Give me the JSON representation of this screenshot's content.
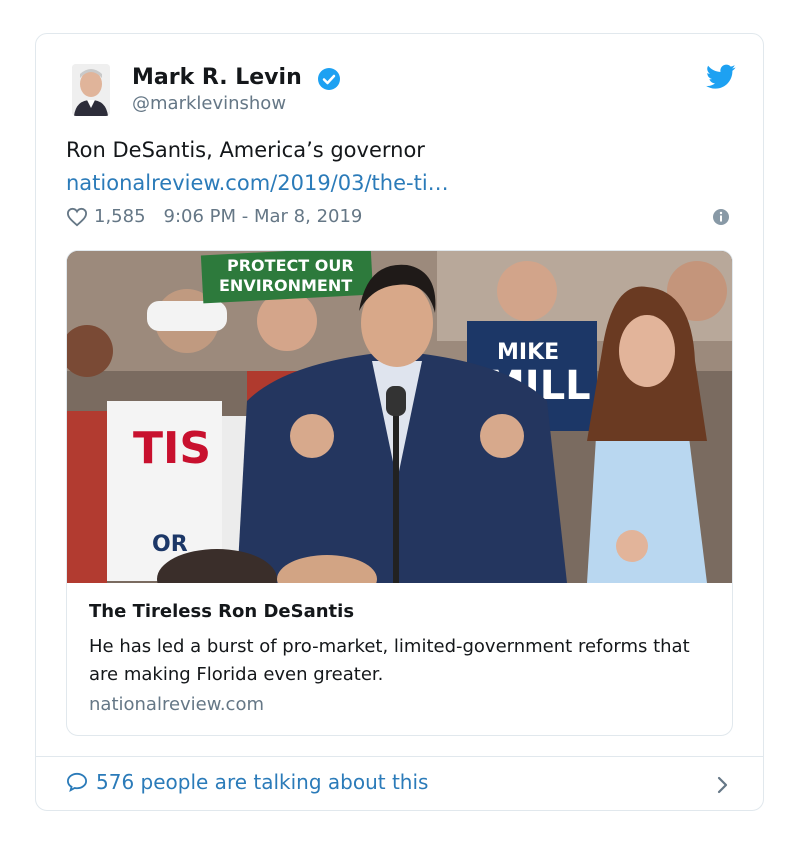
{
  "tweet": {
    "author_name": "Mark R. Levin",
    "handle": "@marklevinshow",
    "verified": true,
    "text": "Ron DeSantis, America’s governor",
    "link_text": "nationalreview.com/2019/03/the-ti…",
    "like_count": "1,585",
    "timestamp": "9:06 PM - Mar 8, 2019"
  },
  "link_card": {
    "image_signs": {
      "protect": "PROTECT OUR",
      "environment": "ENVIRONMENT",
      "mike": "MIKE",
      "mill": "MILL",
      "tis": "TIS",
      "or": "OR"
    },
    "title": "The Tireless Ron DeSantis",
    "description": "He has led a burst of pro-market, limited-government reforms that are making Florida even greater.",
    "domain": "nationalreview.com"
  },
  "footer": {
    "talking_text": "576 people are talking about this"
  },
  "colors": {
    "twitter_blue": "#1da1f2",
    "link_blue": "#2b7bb9",
    "muted": "#657786",
    "border": "#e1e8ed"
  },
  "icons": [
    "twitter-bird-icon",
    "verified-badge-icon",
    "heart-icon",
    "info-icon",
    "comment-bubble-icon",
    "chevron-right-icon"
  ]
}
